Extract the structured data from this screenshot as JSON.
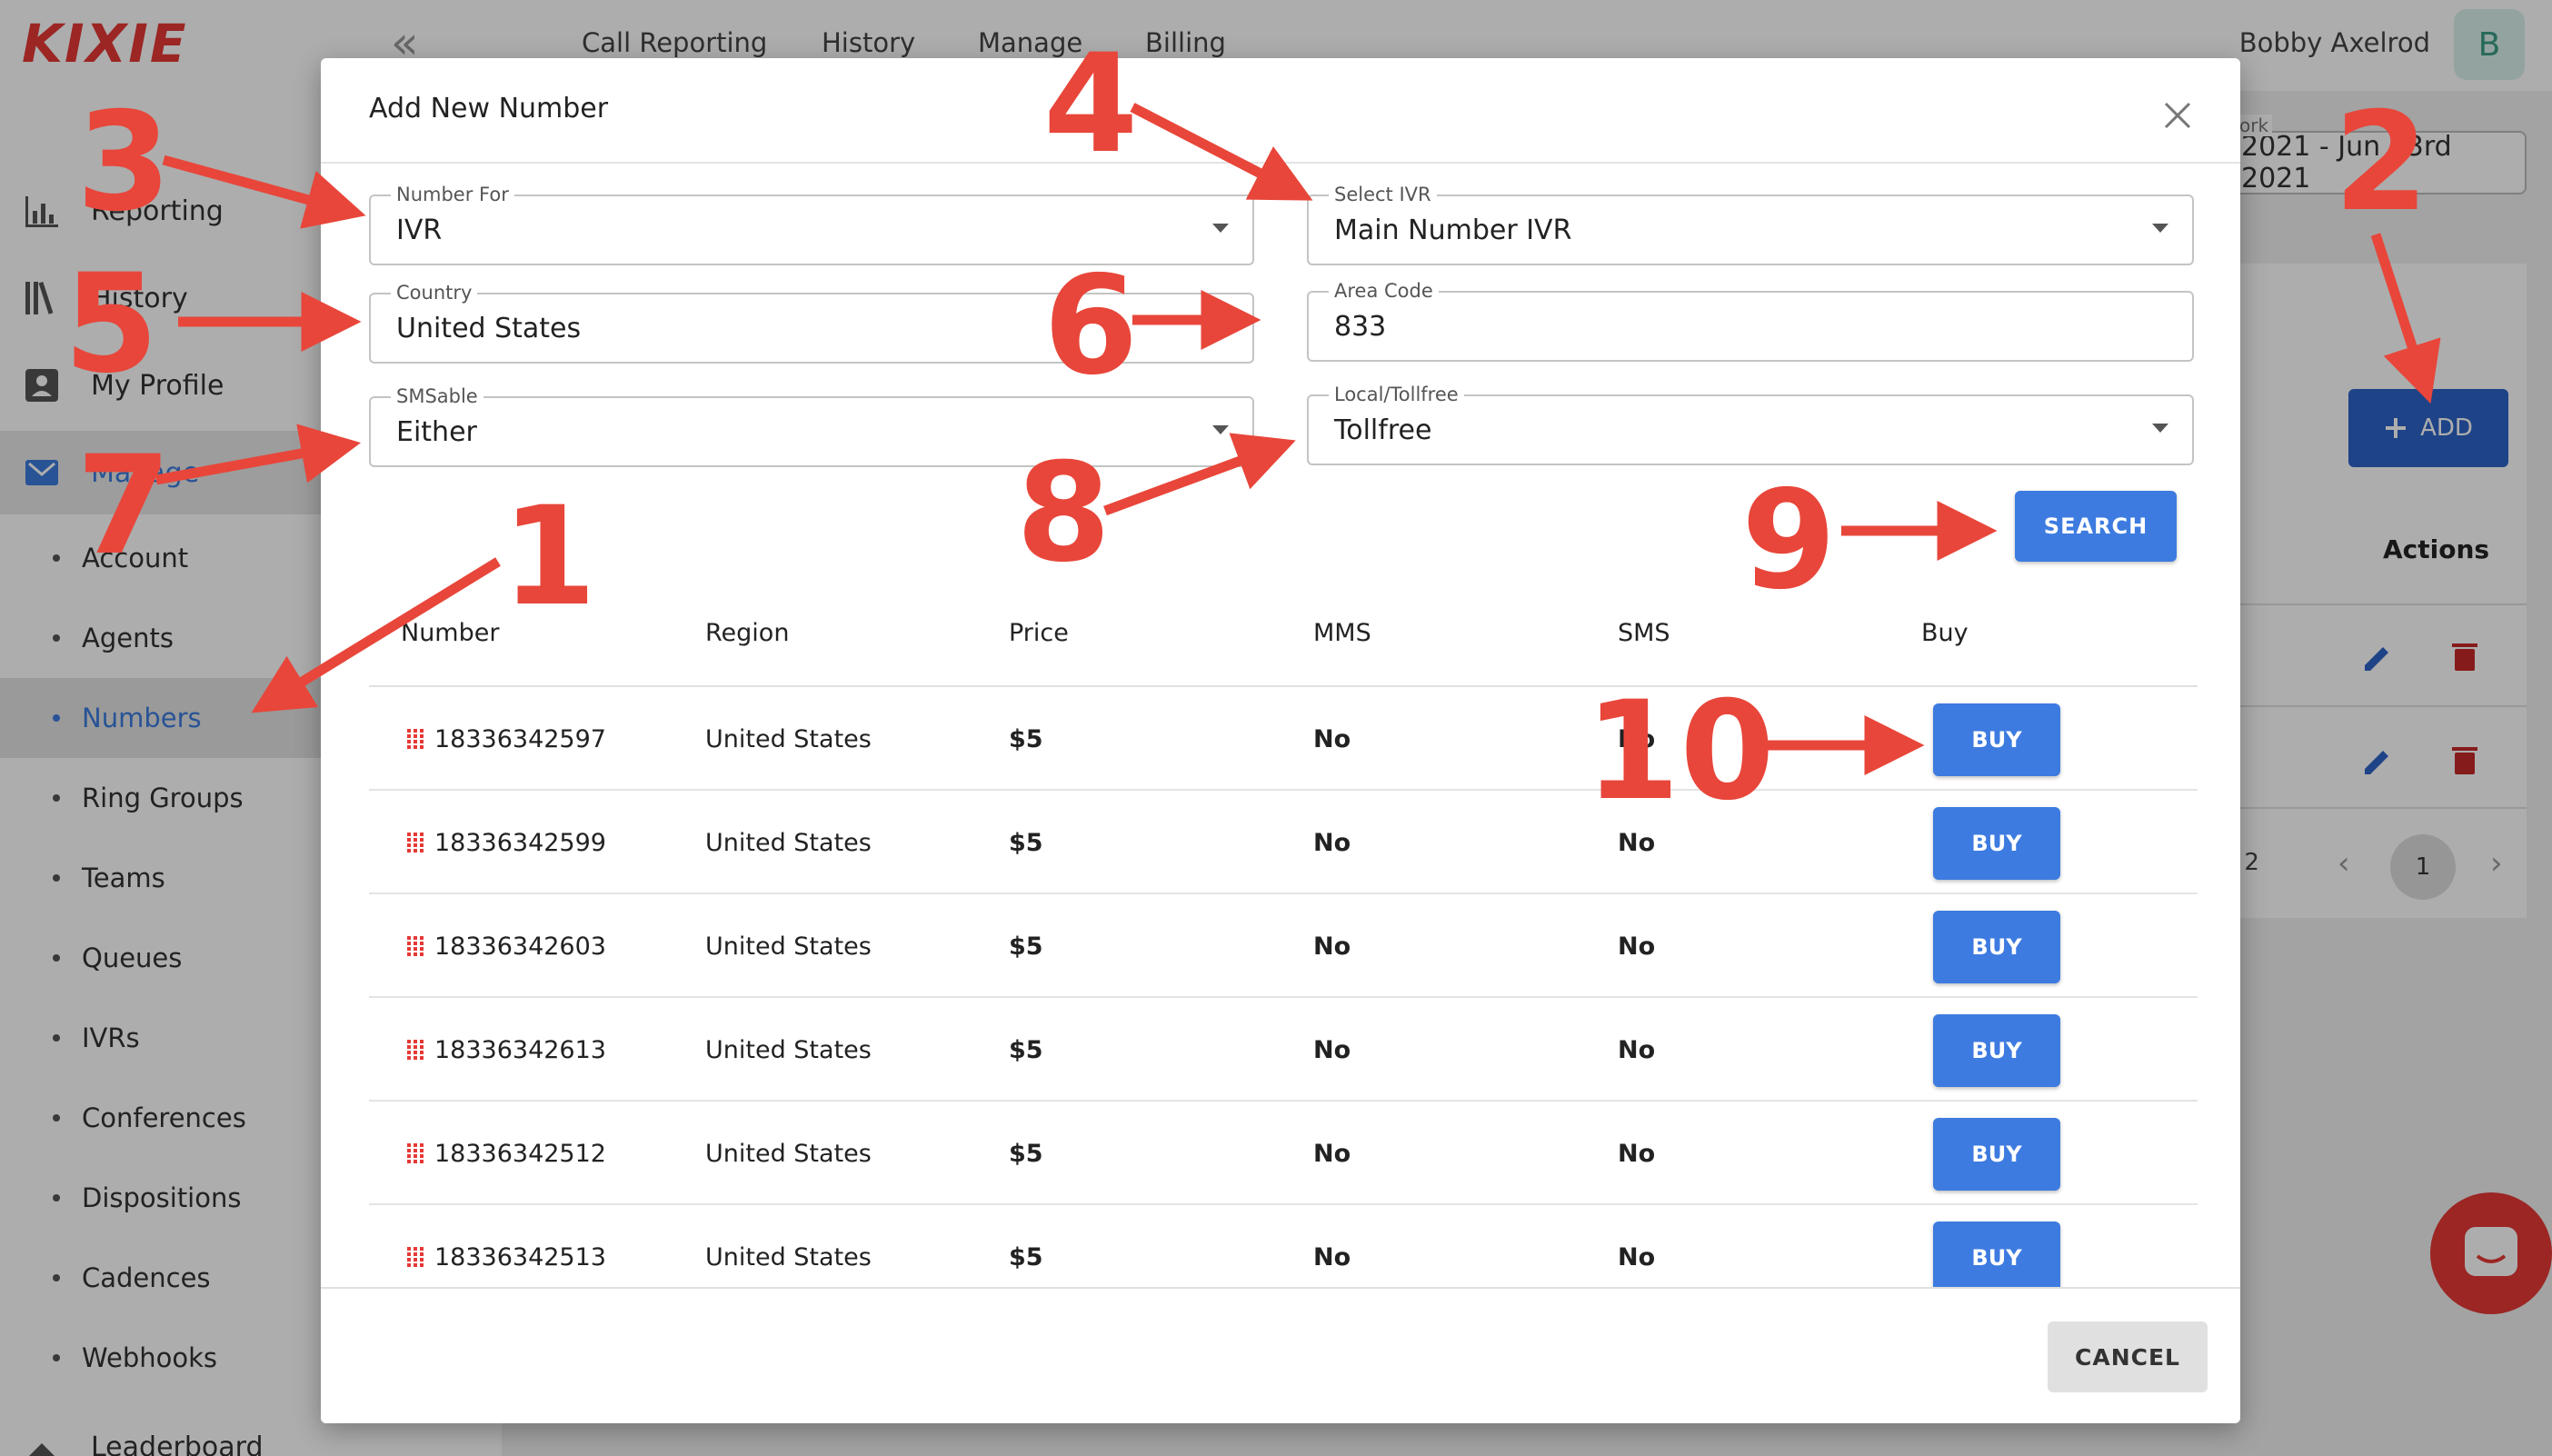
{
  "app": {
    "logo": "KIXIE",
    "collapse_label": "«"
  },
  "sidebar": {
    "items": [
      {
        "label": "Reporting",
        "icon": "bar-chart-icon"
      },
      {
        "label": "History",
        "icon": "history-icon"
      },
      {
        "label": "My Profile",
        "icon": "profile-icon"
      },
      {
        "label": "Manage",
        "icon": "manage-icon"
      }
    ],
    "sub_items": [
      "Account",
      "Agents",
      "Numbers",
      "Ring Groups",
      "Teams",
      "Queues",
      "IVRs",
      "Conferences",
      "Dispositions",
      "Cadences",
      "Webhooks",
      "Leaderboard"
    ]
  },
  "topnav": {
    "items": [
      "Call Reporting",
      "History",
      "Manage",
      "Billing"
    ],
    "user_name": "Bobby Axelrod",
    "avatar_initial": "B"
  },
  "background": {
    "date_label": "ork",
    "date_value": "2021 - Jun 23rd 2021",
    "add_label": "ADD",
    "actions_header": "Actions",
    "pager_of": "f 2",
    "pager_current": "1",
    "pager_prev": "‹",
    "pager_next": "›"
  },
  "modal": {
    "title": "Add New Number",
    "fields": {
      "number_for": {
        "label": "Number For",
        "value": "IVR"
      },
      "select_ivr": {
        "label": "Select IVR",
        "value": "Main Number IVR"
      },
      "country": {
        "label": "Country",
        "value": "United States"
      },
      "area_code": {
        "label": "Area Code",
        "value": "833"
      },
      "smsable": {
        "label": "SMSable",
        "value": "Either"
      },
      "local_tollfree": {
        "label": "Local/Tollfree",
        "value": "Tollfree"
      }
    },
    "search_label": "SEARCH",
    "table": {
      "headers": [
        "Number",
        "Region",
        "Price",
        "MMS",
        "SMS",
        "Buy"
      ],
      "rows": [
        {
          "number": "18336342597",
          "region": "United States",
          "price": "$5",
          "mms": "No",
          "sms": "No",
          "buy": "BUY"
        },
        {
          "number": "18336342599",
          "region": "United States",
          "price": "$5",
          "mms": "No",
          "sms": "No",
          "buy": "BUY"
        },
        {
          "number": "18336342603",
          "region": "United States",
          "price": "$5",
          "mms": "No",
          "sms": "No",
          "buy": "BUY"
        },
        {
          "number": "18336342613",
          "region": "United States",
          "price": "$5",
          "mms": "No",
          "sms": "No",
          "buy": "BUY"
        },
        {
          "number": "18336342512",
          "region": "United States",
          "price": "$5",
          "mms": "No",
          "sms": "No",
          "buy": "BUY"
        },
        {
          "number": "18336342513",
          "region": "United States",
          "price": "$5",
          "mms": "No",
          "sms": "No",
          "buy": "BUY"
        }
      ]
    },
    "cancel_label": "CANCEL"
  },
  "annotations": [
    "1",
    "2",
    "3",
    "4",
    "5",
    "6",
    "7",
    "8",
    "9",
    "10"
  ],
  "colors": {
    "accent": "#3d7be0",
    "annotation": "#e8463a",
    "brand": "#e53935"
  }
}
